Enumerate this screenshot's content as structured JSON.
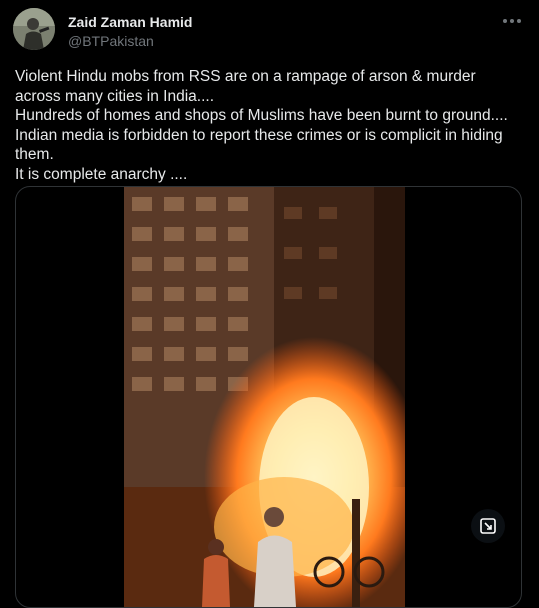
{
  "user": {
    "display_name": "Zaid Zaman Hamid",
    "handle": "@BTPakistan"
  },
  "tweet": {
    "lines": [
      "Violent Hindu mobs from RSS are on a rampage of arson & murder",
      "across many cities in India....",
      "Hundreds of homes and shops of Muslims have been burnt to ground....",
      "Indian media is forbidden to report these crimes or is complicit in hiding",
      "them.",
      "It is complete anarchy ...."
    ]
  },
  "icons": {
    "more": "more-options-icon",
    "expand": "expand-video-icon"
  },
  "colors": {
    "background": "#000000",
    "text": "#e7e9ea",
    "secondary": "#71767b",
    "border": "#2f3336"
  }
}
